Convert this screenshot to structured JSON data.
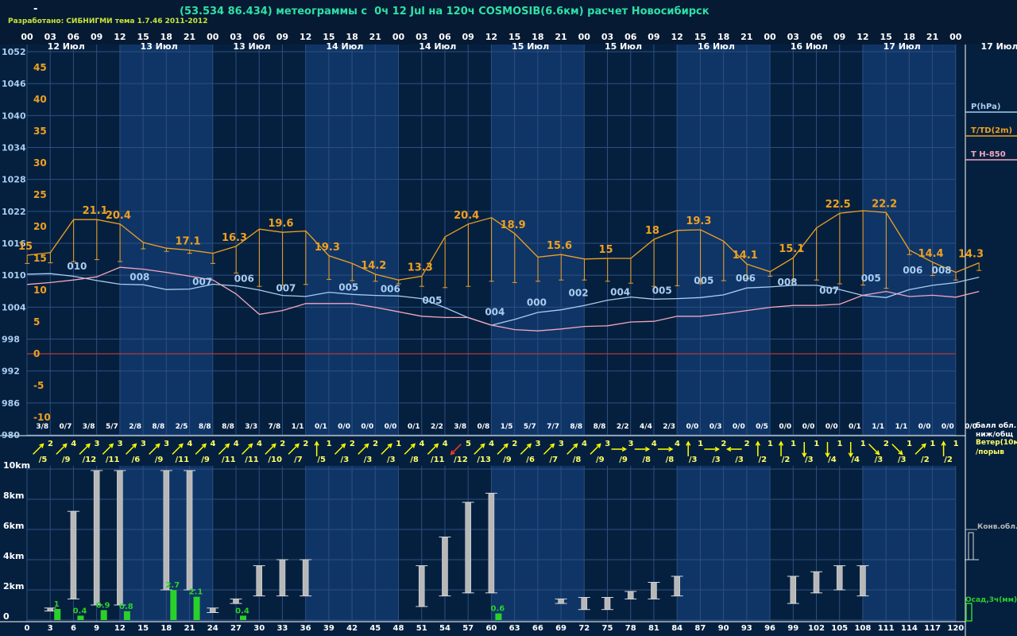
{
  "header": {
    "dash": "-",
    "title": "(53.534 86.434) метеограммы с  0ч 12 Jul на 120ч COSMOSIB(6.6км) расчет Новосибирск",
    "developer": "Разработано: СИБНИГМИ тема 1.7.46 2011-2012"
  },
  "colors": {
    "background": "#05203f",
    "band_light": "#0f3567",
    "grid": "#2e4f7f",
    "pressure": "#a9cdf0",
    "temperature": "#f0a020",
    "t850": "#f4a6bc",
    "zero_line": "#b03a3a",
    "cloud_bar": "#b8b8b8",
    "precip_bar": "#2ad12a",
    "wind_arrow": "#ffff00",
    "wind_arrow_alt": "#ff3b1f",
    "label_white": "#ffffff",
    "label_blue": "#a9cdf0",
    "label_orange": "#f0a020",
    "label_yellow": "#ffff66",
    "label_green": "#2ad12a"
  },
  "time_axis": {
    "top_hours": [
      "00",
      "03",
      "06",
      "09",
      "12",
      "15",
      "18",
      "21",
      "00",
      "03",
      "06",
      "09",
      "12",
      "15",
      "18",
      "21",
      "00",
      "03",
      "06",
      "09",
      "12",
      "15",
      "18",
      "21",
      "00",
      "03",
      "06",
      "09",
      "12",
      "15",
      "18",
      "21",
      "00",
      "03",
      "06",
      "09",
      "12",
      "15",
      "18",
      "21",
      "00"
    ],
    "day_labels": [
      {
        "text": "12 Июл",
        "slot": 1
      },
      {
        "text": "13 Июл",
        "slot": 5
      },
      {
        "text": "13 Июл",
        "slot": 9
      },
      {
        "text": "14 Июл",
        "slot": 13
      },
      {
        "text": "14 Июл",
        "slot": 17
      },
      {
        "text": "15 Июл",
        "slot": 21
      },
      {
        "text": "15 Июл",
        "slot": 25
      },
      {
        "text": "16 Июл",
        "slot": 29
      },
      {
        "text": "16 Июл",
        "slot": 33
      },
      {
        "text": "17 Июл",
        "slot": 37
      },
      {
        "text": "17 Июл",
        "slot": 41
      }
    ],
    "bottom_hours": [
      "0",
      "3",
      "6",
      "9",
      "12",
      "15",
      "18",
      "21",
      "24",
      "27",
      "30",
      "33",
      "36",
      "39",
      "42",
      "45",
      "48",
      "51",
      "54",
      "57",
      "60",
      "63",
      "66",
      "69",
      "72",
      "75",
      "78",
      "81",
      "84",
      "87",
      "90",
      "93",
      "96",
      "99",
      "102",
      "105",
      "108",
      "111",
      "114",
      "117",
      "120"
    ]
  },
  "left_axis": {
    "pressure_ticks": [
      "1052",
      "1046",
      "1040",
      "1034",
      "1028",
      "1022",
      "1016",
      "1010",
      "1004",
      "998",
      "992",
      "986",
      "980"
    ],
    "temp_ticks": [
      "45",
      "40",
      "35",
      "30",
      "25",
      "20",
      "15",
      "10",
      "5",
      "0",
      "-5",
      "-10"
    ],
    "height_ticks": [
      "10km",
      "8km",
      "6km",
      "4km",
      "2km",
      "0"
    ]
  },
  "legend": {
    "pressure": "P(hPa)",
    "temperature": "T/TD(2m)",
    "t850": "T H-850",
    "cloud_cover_line1": "балл обл.",
    "cloud_cover_line2": "ниж/общ",
    "wind_line1": "Ветер(10м",
    "wind_line2": "/порыв",
    "conv_cloud": "Конв.обл.",
    "precip": "Осад,3ч(мм)"
  },
  "chart_data": {
    "type": "meteogram",
    "x_hours": [
      0,
      3,
      6,
      9,
      12,
      15,
      18,
      21,
      24,
      27,
      30,
      33,
      36,
      39,
      42,
      45,
      48,
      51,
      54,
      57,
      60,
      63,
      66,
      69,
      72,
      75,
      78,
      81,
      84,
      87,
      90,
      93,
      96,
      99,
      102,
      105,
      108,
      111,
      114,
      117,
      120
    ],
    "pressure_hpa": {
      "ylim": [
        980,
        1052
      ],
      "values": [
        1010.2,
        1010.3,
        1009.8,
        1009.0,
        1008.3,
        1008.2,
        1007.3,
        1007.4,
        1008.3,
        1008.0,
        1007.2,
        1006.2,
        1006.0,
        1006.8,
        1006.4,
        1006.2,
        1006.1,
        1005.6,
        1003.9,
        1002.0,
        1000.6,
        1001.7,
        1003.0,
        1003.5,
        1004.3,
        1005.3,
        1005.9,
        1005.5,
        1005.6,
        1005.8,
        1006.3,
        1007.6,
        1007.8,
        1008.1,
        1008.1,
        1007.3,
        1006.2,
        1005.8,
        1007.3,
        1008.1,
        1008.6,
        1009.6
      ]
    },
    "temperature_2m_c": {
      "ylim": [
        -10,
        45
      ],
      "values": [
        15.5,
        15.9,
        21.1,
        21.1,
        20.4,
        17.5,
        16.6,
        16.3,
        15.8,
        16.9,
        19.6,
        19.1,
        19.3,
        15.4,
        14.2,
        12.5,
        11.6,
        12.2,
        18.4,
        20.4,
        21.4,
        18.9,
        15.2,
        15.6,
        14.9,
        15.0,
        15.0,
        18.0,
        19.4,
        19.5,
        17.7,
        14.1,
        12.9,
        15.1,
        19.8,
        22.1,
        22.5,
        22.2,
        16.3,
        14.4,
        12.8,
        14.3
      ],
      "labels": [
        {
          "hour": 0,
          "text": "15"
        },
        {
          "hour": 9,
          "text": "21.1"
        },
        {
          "hour": 12,
          "text": "20.4"
        },
        {
          "hour": 21,
          "text": "17.1"
        },
        {
          "hour": 27,
          "text": "16.3"
        },
        {
          "hour": 33,
          "text": "19.6"
        },
        {
          "hour": 39,
          "text": "19.3"
        },
        {
          "hour": 45,
          "text": "14.2"
        },
        {
          "hour": 51,
          "text": "13.3"
        },
        {
          "hour": 57,
          "text": "20.4"
        },
        {
          "hour": 63,
          "text": "18.9"
        },
        {
          "hour": 69,
          "text": "15.6"
        },
        {
          "hour": 75,
          "text": "15"
        },
        {
          "hour": 81,
          "text": "18"
        },
        {
          "hour": 87,
          "text": "19.3"
        },
        {
          "hour": 93,
          "text": "14.1"
        },
        {
          "hour": 99,
          "text": "15.1"
        },
        {
          "hour": 105,
          "text": "22.5"
        },
        {
          "hour": 111,
          "text": "22.2"
        },
        {
          "hour": 117,
          "text": "14.4"
        },
        {
          "hour": 123,
          "text": "14.3"
        }
      ],
      "dewpoint_c": [
        14.2,
        14.3,
        14.5,
        14.8,
        14.5,
        16.5,
        16.1,
        15.8,
        14.2,
        12.7,
        10.6,
        10.8,
        10.9,
        11.7,
        11.5,
        11.4,
        11.0,
        10.6,
        10.4,
        10.6,
        11.4,
        11.2,
        11.4,
        11.6,
        11.6,
        11.4,
        11.1,
        10.6,
        10.7,
        11.0,
        11.5,
        11.8,
        12.2,
        11.5,
        11.6,
        11.0,
        10.8,
        10.3,
        15.6,
        12.3,
        11.6,
        13.1
      ]
    },
    "pressure_labels": [
      {
        "hour": 3,
        "text": "010"
      },
      {
        "hour": 12,
        "text": "008"
      },
      {
        "hour": 21,
        "text": "007"
      },
      {
        "hour": 27,
        "text": "006"
      },
      {
        "hour": 33,
        "text": "007"
      },
      {
        "hour": 42,
        "text": "005"
      },
      {
        "hour": 48,
        "text": "006"
      },
      {
        "hour": 54,
        "text": "005"
      },
      {
        "hour": 63,
        "text": "004"
      },
      {
        "hour": 69,
        "text": "000"
      },
      {
        "hour": 75,
        "text": "002"
      },
      {
        "hour": 81,
        "text": "004"
      },
      {
        "hour": 87,
        "text": "005"
      },
      {
        "hour": 93,
        "text": "005"
      },
      {
        "hour": 99,
        "text": "006"
      },
      {
        "hour": 105,
        "text": "008"
      },
      {
        "hour": 111,
        "text": "007"
      },
      {
        "hour": 117,
        "text": "005"
      },
      {
        "hour": 123,
        "text": "006"
      },
      {
        "hour": 129,
        "text": "008"
      }
    ],
    "t850_c": [
      10.9,
      11.2,
      11.6,
      12.1,
      13.6,
      13.3,
      12.8,
      12.2,
      11.6,
      9.4,
      6.2,
      6.8,
      7.9,
      7.9,
      7.9,
      7.3,
      6.6,
      5.9,
      5.7,
      5.7,
      4.5,
      3.8,
      3.6,
      3.9,
      4.3,
      4.4,
      5.0,
      5.1,
      5.9,
      5.9,
      6.3,
      6.8,
      7.3,
      7.6,
      7.6,
      7.8,
      9.2,
      9.8,
      9.0,
      9.2,
      8.9,
      9.8
    ],
    "cloud_cover_low_total": [
      "3/8",
      "0/7",
      "3/8",
      "5/7",
      "2/8",
      "8/8",
      "2/5",
      "8/8",
      "8/8",
      "3/3",
      "7/8",
      "1/1",
      "0/1",
      "0/0",
      "0/0",
      "0/0",
      "0/1",
      "2/2",
      "3/8",
      "0/8",
      "1/5",
      "5/7",
      "7/7",
      "8/8",
      "8/8",
      "2/2",
      "4/4",
      "2/3",
      "0/0",
      "0/3",
      "0/0",
      "0/5",
      "0/0",
      "0/0",
      "0/0",
      "0/1",
      "1/1",
      "1/1",
      "0/0",
      "0/0",
      "0/0"
    ],
    "wind_10m_gust": [
      {
        "speed": 2,
        "gust": 5,
        "dir": "SW"
      },
      {
        "speed": 4,
        "gust": 9,
        "dir": "SW"
      },
      {
        "speed": 3,
        "gust": 12,
        "dir": "SW"
      },
      {
        "speed": 3,
        "gust": 11,
        "dir": "SW"
      },
      {
        "speed": 3,
        "gust": 6,
        "dir": "SW"
      },
      {
        "speed": 3,
        "gust": 9,
        "dir": "SW"
      },
      {
        "speed": 4,
        "gust": 11,
        "dir": "SW"
      },
      {
        "speed": 4,
        "gust": 9,
        "dir": "SW"
      },
      {
        "speed": 4,
        "gust": 11,
        "dir": "SW"
      },
      {
        "speed": 4,
        "gust": 11,
        "dir": "SW"
      },
      {
        "speed": 2,
        "gust": 10,
        "dir": "SW"
      },
      {
        "speed": 2,
        "gust": 7,
        "dir": "SW"
      },
      {
        "speed": 1,
        "gust": 5,
        "dir": "S"
      },
      {
        "speed": 2,
        "gust": 3,
        "dir": "SW"
      },
      {
        "speed": 2,
        "gust": 3,
        "dir": "SW"
      },
      {
        "speed": 1,
        "gust": 3,
        "dir": "SW"
      },
      {
        "speed": 4,
        "gust": 8,
        "dir": "SW"
      },
      {
        "speed": 4,
        "gust": 11,
        "dir": "SW"
      },
      {
        "speed": 5,
        "gust": 12,
        "dir": "NE"
      },
      {
        "speed": 4,
        "gust": 13,
        "dir": "SW"
      },
      {
        "speed": 2,
        "gust": 9,
        "dir": "SW"
      },
      {
        "speed": 3,
        "gust": 6,
        "dir": "SW"
      },
      {
        "speed": 3,
        "gust": 7,
        "dir": "SW"
      },
      {
        "speed": 4,
        "gust": 8,
        "dir": "SW"
      },
      {
        "speed": 3,
        "gust": 9,
        "dir": "SW"
      },
      {
        "speed": 3,
        "gust": 9,
        "dir": "W"
      },
      {
        "speed": 4,
        "gust": 8,
        "dir": "W"
      },
      {
        "speed": 4,
        "gust": 8,
        "dir": "W"
      },
      {
        "speed": 1,
        "gust": 3,
        "dir": "S"
      },
      {
        "speed": 2,
        "gust": 3,
        "dir": "W"
      },
      {
        "speed": 2,
        "gust": 3,
        "dir": "E"
      },
      {
        "speed": 1,
        "gust": 2,
        "dir": "S"
      },
      {
        "speed": 1,
        "gust": 2,
        "dir": "S"
      },
      {
        "speed": 1,
        "gust": 3,
        "dir": "N"
      },
      {
        "speed": 1,
        "gust": 4,
        "dir": "N"
      },
      {
        "speed": 1,
        "gust": 4,
        "dir": "N"
      },
      {
        "speed": 2,
        "gust": 3,
        "dir": "NW"
      },
      {
        "speed": 1,
        "gust": 3,
        "dir": "NW"
      },
      {
        "speed": 1,
        "gust": 2,
        "dir": "SW"
      },
      {
        "speed": 1,
        "gust": 2,
        "dir": "S"
      }
    ],
    "convective_clouds_km": [
      {
        "hour": 3,
        "base": 0.6,
        "top": 0.8
      },
      {
        "hour": 6,
        "base": 1.4,
        "top": 7.2
      },
      {
        "hour": 9,
        "base": 1.0,
        "top": 9.9
      },
      {
        "hour": 12,
        "base": 1.0,
        "top": 9.9
      },
      {
        "hour": 18,
        "base": 2.0,
        "top": 9.9
      },
      {
        "hour": 21,
        "base": 2.0,
        "top": 9.9
      },
      {
        "hour": 24,
        "base": 0.5,
        "top": 0.8
      },
      {
        "hour": 27,
        "base": 1.1,
        "top": 1.4
      },
      {
        "hour": 30,
        "base": 1.6,
        "top": 3.6
      },
      {
        "hour": 33,
        "base": 1.6,
        "top": 4.0
      },
      {
        "hour": 36,
        "base": 1.6,
        "top": 4.0
      },
      {
        "hour": 51,
        "base": 0.9,
        "top": 3.6
      },
      {
        "hour": 54,
        "base": 1.6,
        "top": 5.5
      },
      {
        "hour": 57,
        "base": 1.8,
        "top": 7.8
      },
      {
        "hour": 60,
        "base": 1.8,
        "top": 8.4
      },
      {
        "hour": 69,
        "base": 1.1,
        "top": 1.4
      },
      {
        "hour": 72,
        "base": 0.7,
        "top": 1.5
      },
      {
        "hour": 75,
        "base": 0.7,
        "top": 1.5
      },
      {
        "hour": 78,
        "base": 1.4,
        "top": 1.9
      },
      {
        "hour": 81,
        "base": 1.4,
        "top": 2.5
      },
      {
        "hour": 84,
        "base": 1.6,
        "top": 2.9
      },
      {
        "hour": 99,
        "base": 1.1,
        "top": 2.9
      },
      {
        "hour": 102,
        "base": 1.8,
        "top": 3.2
      },
      {
        "hour": 105,
        "base": 2.0,
        "top": 3.6
      },
      {
        "hour": 108,
        "base": 1.6,
        "top": 3.6
      }
    ],
    "precip_3h_mm": [
      {
        "hour": 3,
        "value": 1
      },
      {
        "hour": 6,
        "value": 0.4
      },
      {
        "hour": 9,
        "value": 0.9
      },
      {
        "hour": 12,
        "value": 0.8
      },
      {
        "hour": 18,
        "value": 2.7
      },
      {
        "hour": 21,
        "value": 2.1
      },
      {
        "hour": 27,
        "value": 0.4
      },
      {
        "hour": 60,
        "value": 0.6
      }
    ],
    "height_ylim_km": [
      0,
      10
    ]
  }
}
